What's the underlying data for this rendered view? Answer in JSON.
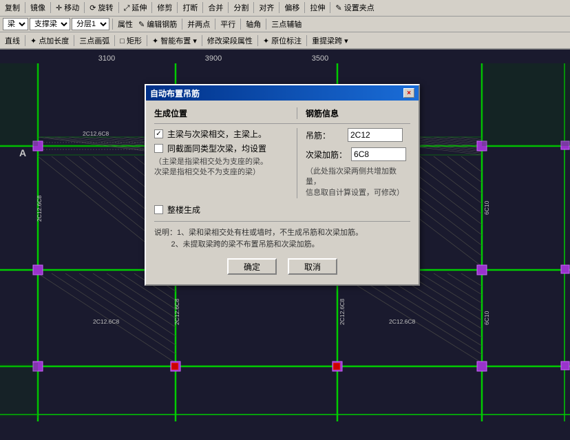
{
  "toolbar": {
    "row1": {
      "items": [
        "复制",
        "镜像",
        "移动",
        "旋转",
        "延伸",
        "修剪",
        "打断",
        "合并",
        "分割",
        "对齐",
        "偏移",
        "拉伸",
        "设置夹点"
      ]
    },
    "row2": {
      "dropdowns": [
        "梁",
        "支撑梁",
        "分层1"
      ],
      "buttons": [
        "属性",
        "编辑钢筋",
        "并两点",
        "平行",
        "轴角",
        "三点辅轴"
      ]
    },
    "row3": {
      "buttons": [
        "直线",
        "点加长度",
        "三点画弧",
        "矩形",
        "智能布置",
        "修改梁段属性",
        "原位标注",
        "重提梁跨"
      ]
    }
  },
  "grid": {
    "numbers": [
      "3100",
      "3900",
      "3500"
    ],
    "letters": [
      "A"
    ]
  },
  "dialog": {
    "title": "自动布置吊筋",
    "close_btn": "×",
    "sections": {
      "left_header": "生成位置",
      "right_header": "钢筋信息"
    },
    "checkboxes": {
      "primary_secondary": {
        "label": "主梁与次梁相交，主梁上。",
        "checked": true
      },
      "same_type": {
        "label": "同截面同类型次梁，均设置",
        "checked": false
      },
      "whole_floor": {
        "label": "整楼生成",
        "checked": false
      }
    },
    "notes": {
      "checkbox_note": "（主梁是指梁相交处为支座的梁。\n次梁是指相交处不为支座的梁）",
      "rebar_note": "（此处指次梁两侧共增加数量，\n信息取自计算设置，可修改）"
    },
    "rebar": {
      "hanging_label": "吊筋：",
      "hanging_value": "2C12",
      "secondary_label": "次梁加筋：",
      "secondary_value": "6C8"
    },
    "instructions": {
      "line1": "说明：1、梁和梁相交处有柱或墙时，不生成吊筋和次梁加筋。",
      "line2": "2、未提取梁跨的梁不布置吊筋和次梁加筋。"
    },
    "buttons": {
      "confirm": "确定",
      "cancel": "取消"
    }
  },
  "cad": {
    "beam_labels": [
      "2C12.6C8",
      "2C12.6C8",
      "2C12.6C8"
    ],
    "vertical_labels": [
      "2C12.6C8",
      "2C12.6C8",
      "6C10"
    ],
    "background_color": "#1a1a2e",
    "grid_color": "#c8c8c8"
  }
}
